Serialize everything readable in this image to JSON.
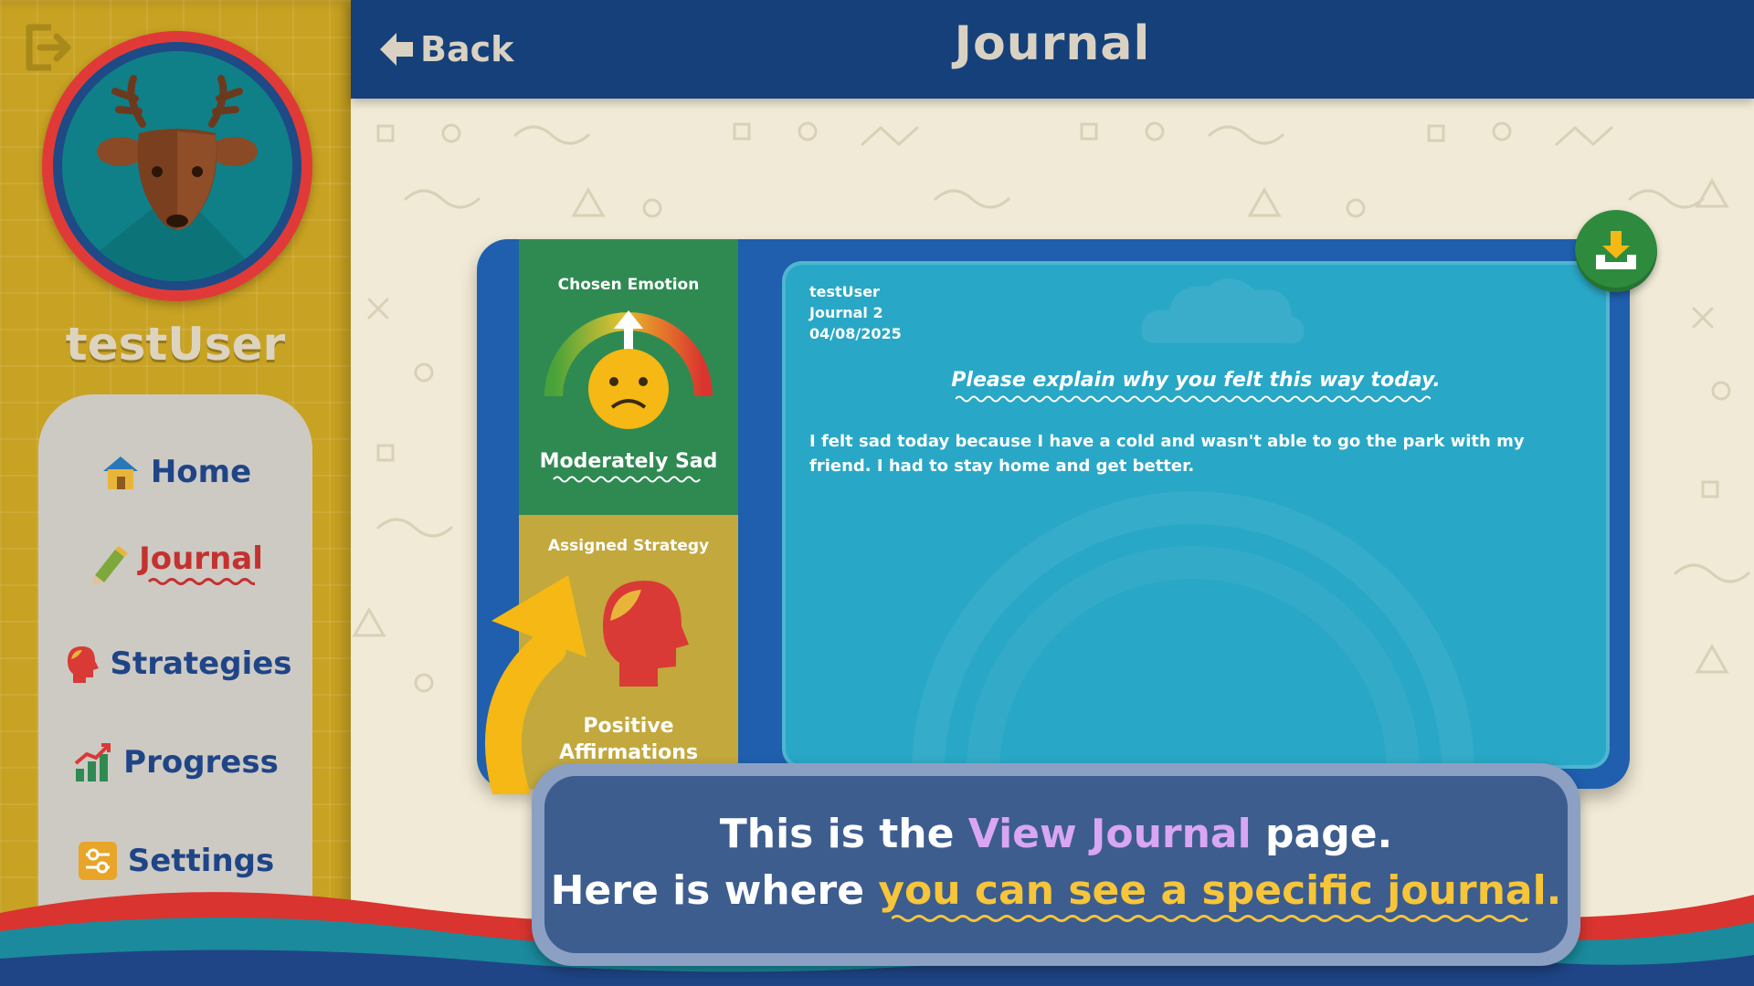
{
  "sidebar": {
    "username": "testUser",
    "nav": [
      {
        "label": "Home",
        "icon": "house-icon"
      },
      {
        "label": "Journal",
        "icon": "pencil-icon"
      },
      {
        "label": "Strategies",
        "icon": "head-icon"
      },
      {
        "label": "Progress",
        "icon": "chart-icon"
      },
      {
        "label": "Settings",
        "icon": "sliders-icon"
      }
    ],
    "active": "Journal",
    "avatar": "deer-icon",
    "logout_icon": "logout-icon"
  },
  "header": {
    "back_label": "Back",
    "title": "Journal"
  },
  "journal": {
    "emotion_heading": "Chosen Emotion",
    "emotion": "Moderately Sad",
    "strategy_heading": "Assigned Strategy",
    "strategy": "Positive Affirmations",
    "user": "testUser",
    "entry_name": "Journal 2",
    "date": "04/08/2025",
    "prompt": "Please explain why you felt this way today.",
    "entry_text": "I felt sad today because I have a cold and wasn't able to go the park with my friend. I had to stay home and get better.",
    "download_icon": "download-icon"
  },
  "tutorial": {
    "line1_prefix": "This is the ",
    "line1_highlight": "View Journal",
    "line1_suffix": " page.",
    "line2_prefix": "Here is where ",
    "line2_highlight": "you can see a specific journal."
  },
  "colors": {
    "sidebar": "#c8a222",
    "topbar": "#164079",
    "nav_text": "#1f4587",
    "active_nav": "#c4322f",
    "card": "#1f5fae",
    "emotion_panel": "#2f8a52",
    "strategy_panel": "#c2a83d",
    "entry_panel": "#29a7c6",
    "download": "#2e8b3e",
    "tutorial_purple": "#d9a6f3",
    "tutorial_yellow": "#f6c53a"
  }
}
